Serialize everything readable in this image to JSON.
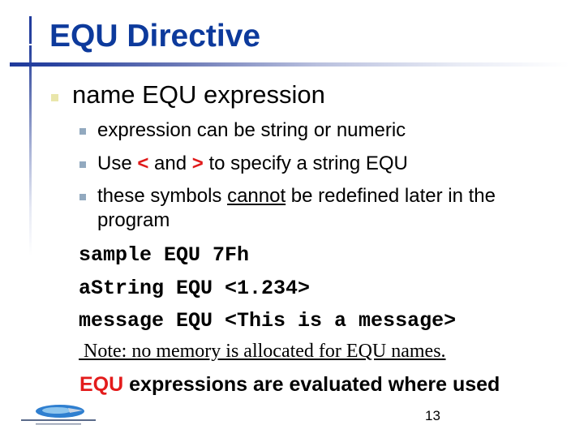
{
  "slide": {
    "title": "EQU Directive",
    "bullet_level1": "name EQU expression",
    "sub_bullets": [
      {
        "text": "expression can be string or numeric"
      },
      {
        "prefix": "Use ",
        "sym1": "<",
        "mid": " and ",
        "sym2": ">",
        "suffix": " to specify a string EQU"
      },
      {
        "prefix": "these symbols ",
        "underlined": "cannot",
        "suffix": " be redefined later in the",
        "continuation": "program"
      }
    ],
    "code_lines": [
      "sample EQU 7Fh",
      "aString EQU <1.234>",
      "message EQU <This is a message>"
    ],
    "note": " Note: no memory is allocated for EQU names.",
    "final_line": {
      "highlight": "EQU",
      "rest": " expressions are evaluated where used"
    },
    "page_number": "13",
    "colors": {
      "title": "#0d3a9c",
      "accent_red": "#e01a1a",
      "bullet_level1": "#e9e6ab",
      "bullet_level2": "#92a9bf"
    },
    "logo_icon": "institution-logo-icon"
  }
}
